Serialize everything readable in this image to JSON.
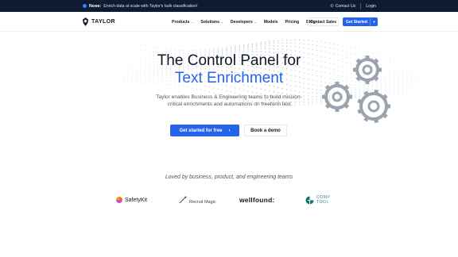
{
  "announcement": {
    "label": "News:",
    "text": "Enrich data at scale with Taylor's bulk classification!",
    "contact": "Contact Us",
    "login": "Login"
  },
  "nav": {
    "brand": "TAYLOR",
    "items": [
      {
        "label": "Products",
        "dropdown": true
      },
      {
        "label": "Solutions",
        "dropdown": true
      },
      {
        "label": "Developers",
        "dropdown": true
      },
      {
        "label": "Models",
        "dropdown": false
      },
      {
        "label": "Pricing",
        "dropdown": false
      },
      {
        "label": "Blog",
        "dropdown": false
      }
    ],
    "contact_sales": "Contact Sales",
    "get_started": "Get Started"
  },
  "hero": {
    "title_line1": "The Control Panel for",
    "title_line2": "Text Enrichment",
    "subtitle": "Taylor enables Business & Engineering teams to build mission-critical enrichments and automations on freeform text",
    "primary_cta": "Get started for free",
    "secondary_cta": "Book a demo"
  },
  "social_proof": {
    "heading": "Loved by business, product, and engineering teams",
    "logos": [
      {
        "name": "SafetyKit"
      },
      {
        "name": "Recruit Magic"
      },
      {
        "name": "wellfound:"
      },
      {
        "name_line1": "COMP",
        "name_line2": "TOOL"
      }
    ]
  },
  "colors": {
    "accent": "#2563eb",
    "announcement_bg": "#0f1a33",
    "heading": "#111827"
  }
}
